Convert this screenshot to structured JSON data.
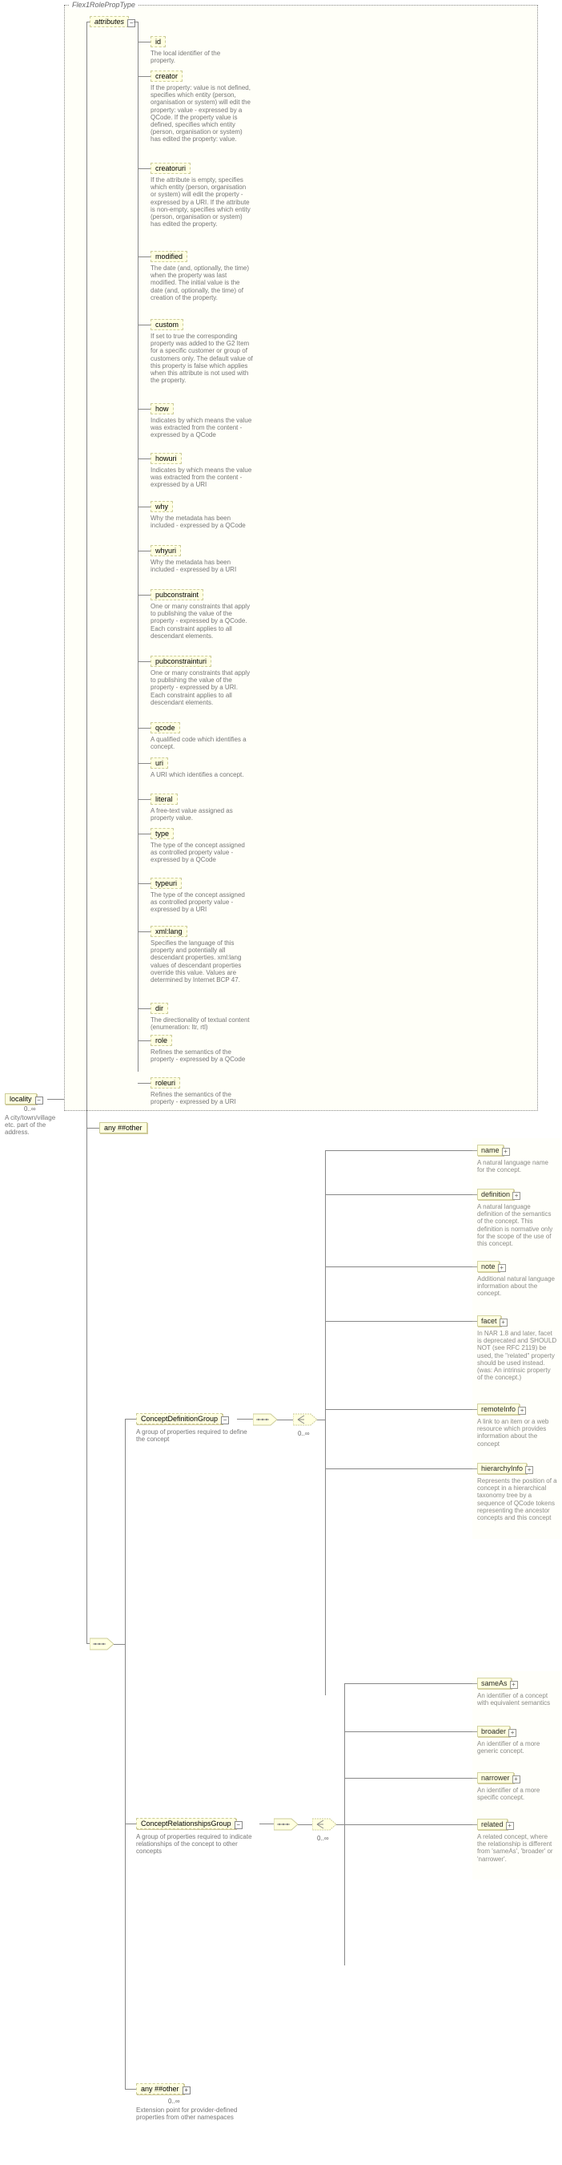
{
  "typeName": "Flex1RolePropType",
  "root": {
    "locality": {
      "label": "locality",
      "occ": "0..∞",
      "desc": "A city/town/village etc. part of the address."
    }
  },
  "attributesHeader": "attributes",
  "attrs": {
    "id": {
      "label": "id",
      "desc": "The local identifier of the property."
    },
    "creator": {
      "label": "creator",
      "desc": "If the property: value is not defined, specifies which entity (person, organisation or system) will edit the property: value - expressed by a QCode. If the property value is defined, specifies which entity (person, organisation or system) has edited the property: value."
    },
    "creatoruri": {
      "label": "creatoruri",
      "desc": "If the attribute is empty, specifies which entity (person, organisation or system) will edit the property - expressed by a URI. If the attribute is non-empty, specifies which entity (person, organisation or system) has edited the property."
    },
    "modified": {
      "label": "modified",
      "desc": "The date (and, optionally, the time) when the property was last modified. The initial value is the date (and, optionally, the time) of creation of the property."
    },
    "custom": {
      "label": "custom",
      "desc": "If set to true the corresponding property was added to the G2 Item for a specific customer or group of customers only. The default value of this property is false which applies when this attribute is not used with the property."
    },
    "how": {
      "label": "how",
      "desc": "Indicates by which means the value was extracted from the content - expressed by a QCode"
    },
    "howuri": {
      "label": "howuri",
      "desc": "Indicates by which means the value was extracted from the content - expressed by a URI"
    },
    "why": {
      "label": "why",
      "desc": "Why the metadata has been included - expressed by a QCode"
    },
    "whyuri": {
      "label": "whyuri",
      "desc": "Why the metadata has been included - expressed by a URI"
    },
    "pubconstraint": {
      "label": "pubconstraint",
      "desc": "One or many constraints that apply to publishing the value of the property - expressed by a QCode. Each constraint applies to all descendant elements."
    },
    "pubconstrainturi": {
      "label": "pubconstrainturi",
      "desc": "One or many constraints that apply to publishing the value of the property - expressed by a URI. Each constraint applies to all descendant elements."
    },
    "qcode": {
      "label": "qcode",
      "desc": "A qualified code which identifies a concept."
    },
    "uri": {
      "label": "uri",
      "desc": "A URI which identifies a concept."
    },
    "literal": {
      "label": "literal",
      "desc": "A free-text value assigned as property value."
    },
    "type": {
      "label": "type",
      "desc": "The type of the concept assigned as controlled property value - expressed by a QCode"
    },
    "typeuri": {
      "label": "typeuri",
      "desc": "The type of the concept assigned as controlled property value - expressed by a URI"
    },
    "xmllang": {
      "label": "xml:lang",
      "desc": "Specifies the language of this property and potentially all descendant properties. xml:lang values of descendant properties override this value. Values are determined by Internet BCP 47."
    },
    "dir": {
      "label": "dir",
      "desc": "The directionality of textual content (enumeration: ltr, rtl)"
    },
    "role": {
      "label": "role",
      "desc": "Refines the semantics of the property - expressed by a QCode"
    },
    "roleuri": {
      "label": "roleuri",
      "desc": "Refines the semantics of the property - expressed by a URI"
    }
  },
  "any1": {
    "label": "any ##other"
  },
  "groups": {
    "cdg": {
      "label": "ConceptDefinitionGroup",
      "desc": "A group of properties required to define the concept",
      "occ": "0..∞"
    },
    "crg": {
      "label": "ConceptRelationshipsGroup",
      "desc": "A group of properties required to indicate relationships of the concept to other concepts",
      "occ": "0..∞"
    }
  },
  "cdgChildren": {
    "name": {
      "label": "name",
      "desc": "A natural language name for the concept."
    },
    "definition": {
      "label": "definition",
      "desc": "A natural language definition of the semantics of the concept. This definition is normative only for the scope of the use of this concept."
    },
    "note": {
      "label": "note",
      "desc": "Additional natural language information about the concept."
    },
    "facet": {
      "label": "facet",
      "desc": "In NAR 1.8 and later, facet is deprecated and SHOULD NOT (see RFC 2119) be used, the \"related\" property should be used instead.(was: An intrinsic property of the concept.)"
    },
    "remoteInfo": {
      "label": "remoteInfo",
      "desc": "A link to an item or a web resource which provides information about the concept"
    },
    "hierarchyInfo": {
      "label": "hierarchyInfo",
      "desc": "Represents the position of a concept in a hierarchical taxonomy tree by a sequence of QCode tokens representing the ancestor concepts and this concept"
    }
  },
  "crgChildren": {
    "sameAs": {
      "label": "sameAs",
      "desc": "An identifier of a concept with equivalent semantics"
    },
    "broader": {
      "label": "broader",
      "desc": "An identifier of a more generic concept."
    },
    "narrower": {
      "label": "narrower",
      "desc": "An identifier of a more specific concept."
    },
    "related": {
      "label": "related",
      "desc": "A related concept, where the relationship is different from 'sameAs', 'broader' or 'narrower'."
    }
  },
  "any2": {
    "label": "any ##other",
    "occ": "0..∞",
    "desc": "Extension point for provider-defined properties from other namespaces"
  }
}
